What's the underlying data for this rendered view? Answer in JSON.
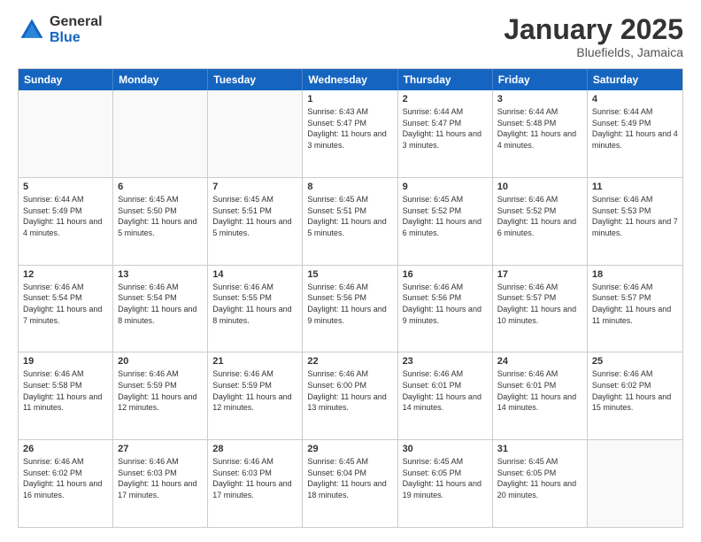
{
  "logo": {
    "general": "General",
    "blue": "Blue"
  },
  "header": {
    "title": "January 2025",
    "location": "Bluefields, Jamaica"
  },
  "days": [
    "Sunday",
    "Monday",
    "Tuesday",
    "Wednesday",
    "Thursday",
    "Friday",
    "Saturday"
  ],
  "weeks": [
    [
      {
        "day": "",
        "info": ""
      },
      {
        "day": "",
        "info": ""
      },
      {
        "day": "",
        "info": ""
      },
      {
        "day": "1",
        "info": "Sunrise: 6:43 AM\nSunset: 5:47 PM\nDaylight: 11 hours and 3 minutes."
      },
      {
        "day": "2",
        "info": "Sunrise: 6:44 AM\nSunset: 5:47 PM\nDaylight: 11 hours and 3 minutes."
      },
      {
        "day": "3",
        "info": "Sunrise: 6:44 AM\nSunset: 5:48 PM\nDaylight: 11 hours and 4 minutes."
      },
      {
        "day": "4",
        "info": "Sunrise: 6:44 AM\nSunset: 5:49 PM\nDaylight: 11 hours and 4 minutes."
      }
    ],
    [
      {
        "day": "5",
        "info": "Sunrise: 6:44 AM\nSunset: 5:49 PM\nDaylight: 11 hours and 4 minutes."
      },
      {
        "day": "6",
        "info": "Sunrise: 6:45 AM\nSunset: 5:50 PM\nDaylight: 11 hours and 5 minutes."
      },
      {
        "day": "7",
        "info": "Sunrise: 6:45 AM\nSunset: 5:51 PM\nDaylight: 11 hours and 5 minutes."
      },
      {
        "day": "8",
        "info": "Sunrise: 6:45 AM\nSunset: 5:51 PM\nDaylight: 11 hours and 5 minutes."
      },
      {
        "day": "9",
        "info": "Sunrise: 6:45 AM\nSunset: 5:52 PM\nDaylight: 11 hours and 6 minutes."
      },
      {
        "day": "10",
        "info": "Sunrise: 6:46 AM\nSunset: 5:52 PM\nDaylight: 11 hours and 6 minutes."
      },
      {
        "day": "11",
        "info": "Sunrise: 6:46 AM\nSunset: 5:53 PM\nDaylight: 11 hours and 7 minutes."
      }
    ],
    [
      {
        "day": "12",
        "info": "Sunrise: 6:46 AM\nSunset: 5:54 PM\nDaylight: 11 hours and 7 minutes."
      },
      {
        "day": "13",
        "info": "Sunrise: 6:46 AM\nSunset: 5:54 PM\nDaylight: 11 hours and 8 minutes."
      },
      {
        "day": "14",
        "info": "Sunrise: 6:46 AM\nSunset: 5:55 PM\nDaylight: 11 hours and 8 minutes."
      },
      {
        "day": "15",
        "info": "Sunrise: 6:46 AM\nSunset: 5:56 PM\nDaylight: 11 hours and 9 minutes."
      },
      {
        "day": "16",
        "info": "Sunrise: 6:46 AM\nSunset: 5:56 PM\nDaylight: 11 hours and 9 minutes."
      },
      {
        "day": "17",
        "info": "Sunrise: 6:46 AM\nSunset: 5:57 PM\nDaylight: 11 hours and 10 minutes."
      },
      {
        "day": "18",
        "info": "Sunrise: 6:46 AM\nSunset: 5:57 PM\nDaylight: 11 hours and 11 minutes."
      }
    ],
    [
      {
        "day": "19",
        "info": "Sunrise: 6:46 AM\nSunset: 5:58 PM\nDaylight: 11 hours and 11 minutes."
      },
      {
        "day": "20",
        "info": "Sunrise: 6:46 AM\nSunset: 5:59 PM\nDaylight: 11 hours and 12 minutes."
      },
      {
        "day": "21",
        "info": "Sunrise: 6:46 AM\nSunset: 5:59 PM\nDaylight: 11 hours and 12 minutes."
      },
      {
        "day": "22",
        "info": "Sunrise: 6:46 AM\nSunset: 6:00 PM\nDaylight: 11 hours and 13 minutes."
      },
      {
        "day": "23",
        "info": "Sunrise: 6:46 AM\nSunset: 6:01 PM\nDaylight: 11 hours and 14 minutes."
      },
      {
        "day": "24",
        "info": "Sunrise: 6:46 AM\nSunset: 6:01 PM\nDaylight: 11 hours and 14 minutes."
      },
      {
        "day": "25",
        "info": "Sunrise: 6:46 AM\nSunset: 6:02 PM\nDaylight: 11 hours and 15 minutes."
      }
    ],
    [
      {
        "day": "26",
        "info": "Sunrise: 6:46 AM\nSunset: 6:02 PM\nDaylight: 11 hours and 16 minutes."
      },
      {
        "day": "27",
        "info": "Sunrise: 6:46 AM\nSunset: 6:03 PM\nDaylight: 11 hours and 17 minutes."
      },
      {
        "day": "28",
        "info": "Sunrise: 6:46 AM\nSunset: 6:03 PM\nDaylight: 11 hours and 17 minutes."
      },
      {
        "day": "29",
        "info": "Sunrise: 6:45 AM\nSunset: 6:04 PM\nDaylight: 11 hours and 18 minutes."
      },
      {
        "day": "30",
        "info": "Sunrise: 6:45 AM\nSunset: 6:05 PM\nDaylight: 11 hours and 19 minutes."
      },
      {
        "day": "31",
        "info": "Sunrise: 6:45 AM\nSunset: 6:05 PM\nDaylight: 11 hours and 20 minutes."
      },
      {
        "day": "",
        "info": ""
      }
    ]
  ]
}
